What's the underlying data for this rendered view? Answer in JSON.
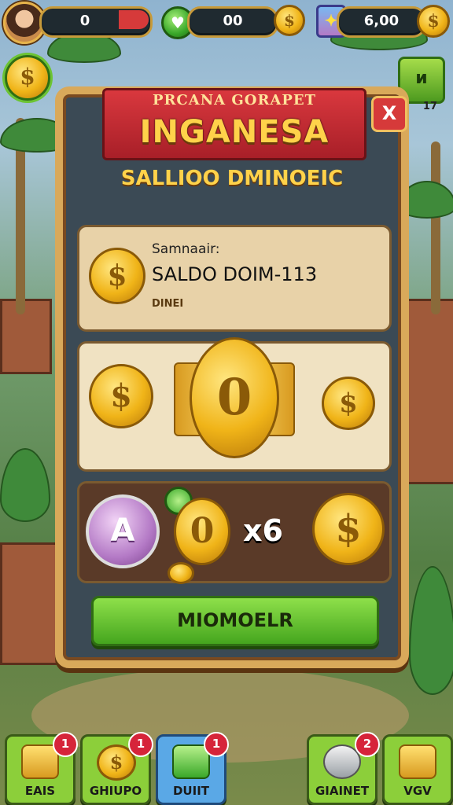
{
  "hud": {
    "counter1": "0",
    "counter2": "00",
    "counter3": "6,00"
  },
  "panel": {
    "ribbon_top": "PRCANA GORAPET",
    "ribbon_title": "INGANESA",
    "close_label": "X",
    "subtitle": "SALLIOO DMINOEIC",
    "balance": {
      "label_small": "Samnaair:",
      "label_big": "SALDO DOIM-113",
      "label_tiny": "DINEI"
    },
    "big_coin": "0",
    "reward": {
      "badge_letter": "A",
      "small_coin": "0",
      "multiplier": "x6"
    },
    "action_button": "MIOMOELR"
  },
  "side": {
    "right_button": "ᴎ",
    "right_number": "17"
  },
  "bottom": [
    {
      "label": "EAIS",
      "badge": "1",
      "icon": "gold-bars-icon",
      "bg": "#8ccf3a"
    },
    {
      "label": "GHIUPO",
      "badge": "1",
      "icon": "coin-icon",
      "bg": "#8ccf3a"
    },
    {
      "label": "DUIIT",
      "badge": "1",
      "icon": "green-gem-icon",
      "bg": "#5aa8e6"
    },
    {
      "label": "GIAINET",
      "badge": "2",
      "icon": "silver-bars-icon",
      "bg": "#8ccf3a"
    },
    {
      "label": "VGV",
      "badge": "",
      "icon": "gold-bar-icon",
      "bg": "#8ccf3a"
    }
  ],
  "colors": {
    "gold": "#f0b418",
    "ribbon_red": "#c22a32",
    "button_green": "#6cc433",
    "panel_slate": "#3b4a55"
  }
}
